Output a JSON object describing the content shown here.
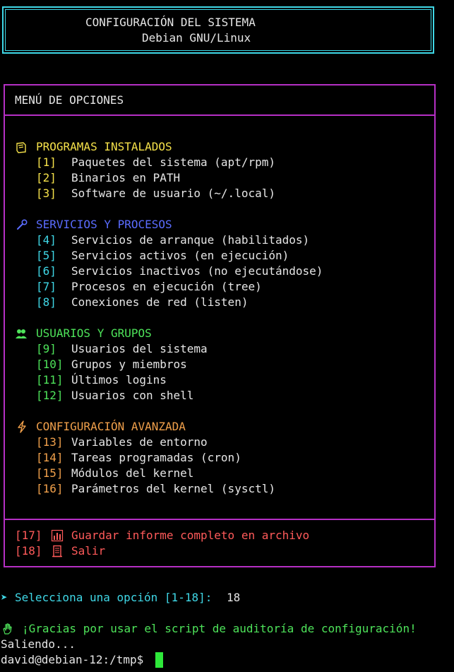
{
  "header": {
    "title": "CONFIGURACIÓN DEL SISTEMA",
    "subtitle": "Debian GNU/Linux"
  },
  "menu": {
    "title": "MENÚ DE OPCIONES",
    "sections": [
      {
        "icon": "package-icon",
        "title": "PROGRAMAS INSTALADOS",
        "color": "#f5e14a",
        "items": [
          {
            "num": "[1]",
            "label": "Paquetes del sistema (apt/rpm)"
          },
          {
            "num": "[2]",
            "label": "Binarios en PATH"
          },
          {
            "num": "[3]",
            "label": "Software de usuario (~/.local)"
          }
        ]
      },
      {
        "icon": "wrench-icon",
        "title": "SERVICIOS Y PROCESOS",
        "color": "#5a6cff",
        "items": [
          {
            "num": "[4]",
            "label": "Servicios de arranque (habilitados)"
          },
          {
            "num": "[5]",
            "label": "Servicios activos (en ejecución)"
          },
          {
            "num": "[6]",
            "label": "Servicios inactivos (no ejecutándose)"
          },
          {
            "num": "[7]",
            "label": "Procesos en ejecución (tree)"
          },
          {
            "num": "[8]",
            "label": "Conexiones de red (listen)"
          }
        ]
      },
      {
        "icon": "users-icon",
        "title": "USUARIOS Y GRUPOS",
        "color": "#4ee35a",
        "items": [
          {
            "num": "[9]",
            "label": "Usuarios del sistema"
          },
          {
            "num": "[10]",
            "label": "Grupos y miembros"
          },
          {
            "num": "[11]",
            "label": "Últimos logins"
          },
          {
            "num": "[12]",
            "label": "Usuarios con shell"
          }
        ]
      },
      {
        "icon": "lightning-icon",
        "title": "CONFIGURACIÓN AVANZADA",
        "color": "#f0a04b",
        "items": [
          {
            "num": "[13]",
            "label": "Variables de entorno"
          },
          {
            "num": "[14]",
            "label": "Tareas programadas (cron)"
          },
          {
            "num": "[15]",
            "label": "Módulos del kernel"
          },
          {
            "num": "[16]",
            "label": "Parámetros del kernel (sysctl)"
          }
        ]
      }
    ],
    "footer": [
      {
        "num": "[17]",
        "icon": "chart-icon",
        "label": "Guardar informe completo en archivo"
      },
      {
        "num": "[18]",
        "icon": "door-icon",
        "label": "Salir"
      }
    ]
  },
  "prompt": {
    "arrow": "➤",
    "text": "Selecciona una opción [1-18]:",
    "value": "18"
  },
  "farewell": {
    "icon": "wave-hand-icon",
    "text": "¡Gracias por usar el script de auditoría de configuración!"
  },
  "exiting": "Saliendo...",
  "shell_prompt": "david@debian-12:/tmp$"
}
